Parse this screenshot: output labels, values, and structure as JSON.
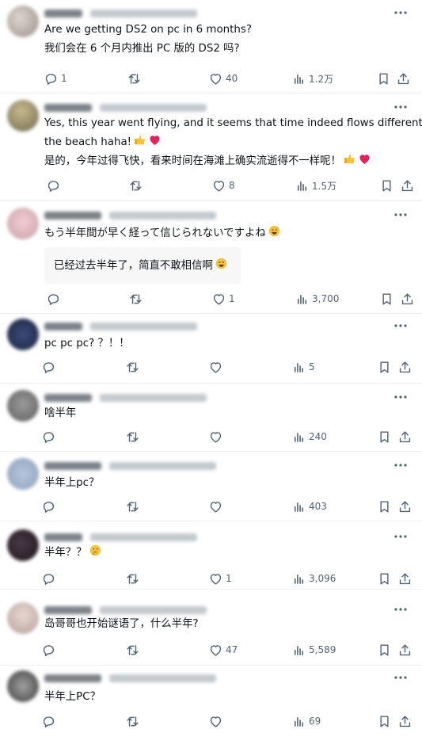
{
  "replies": [
    {
      "lines": [
        "Are we getting DS2 on pc in 6 months?",
        "我们会在 6 个月内推出 PC 版的 DS2 吗?"
      ],
      "stats": {
        "replies": "1",
        "reposts": "",
        "likes": "40",
        "views": "1.2万"
      }
    },
    {
      "lines": [
        "Yes, this year went flying, and it seems that time indeed flows different on",
        "the beach haha!",
        "是的，今年过得飞快，看来时间在海滩上确实流逝得不一样呢！"
      ],
      "stats": {
        "replies": "",
        "reposts": "",
        "likes": "8",
        "views": "1.5万"
      }
    },
    {
      "lines": [
        "もう半年間が早く経って信じられないですよね"
      ],
      "quote": "已经过去半年了，简直不敢相信啊",
      "stats": {
        "replies": "",
        "reposts": "",
        "likes": "1",
        "views": "3,700"
      }
    },
    {
      "lines": [
        "pc pc pc? ？！！"
      ],
      "stats": {
        "replies": "",
        "reposts": "",
        "likes": "",
        "views": "5"
      }
    },
    {
      "lines": [
        "啥半年"
      ],
      "stats": {
        "replies": "",
        "reposts": "",
        "likes": "",
        "views": "240"
      }
    },
    {
      "lines": [
        "半年上pc？"
      ],
      "stats": {
        "replies": "",
        "reposts": "",
        "likes": "",
        "views": "403"
      }
    },
    {
      "lines": [
        "半年？？"
      ],
      "stats": {
        "replies": "",
        "reposts": "",
        "likes": "1",
        "views": "3,096"
      }
    },
    {
      "lines": [
        "岛哥哥也开始谜语了，什么半年?"
      ],
      "stats": {
        "replies": "",
        "reposts": "",
        "likes": "47",
        "views": "5,589"
      }
    },
    {
      "lines": [
        "半年上PC？"
      ],
      "stats": {
        "replies": "",
        "reposts": "",
        "likes": "",
        "views": "69"
      }
    }
  ],
  "icons": {
    "more": "more-horizontal-icon",
    "reply": "reply-bubble-icon",
    "repost": "repost-icon",
    "like": "heart-icon",
    "views": "views-chart-icon",
    "bookmark": "bookmark-icon",
    "share": "share-icon",
    "emoji_thumbs": "thumbs-up-emoji",
    "emoji_heart": "red-heart-emoji",
    "emoji_sweat": "grinning-sweat-emoji",
    "emoji_thinking": "thinking-face-emoji"
  },
  "colors": {
    "text": "#0f1419",
    "muted": "#536471",
    "divider": "#eff3f4",
    "heart_red": "#e0245e",
    "emoji_yellow": "#f7c23c"
  }
}
